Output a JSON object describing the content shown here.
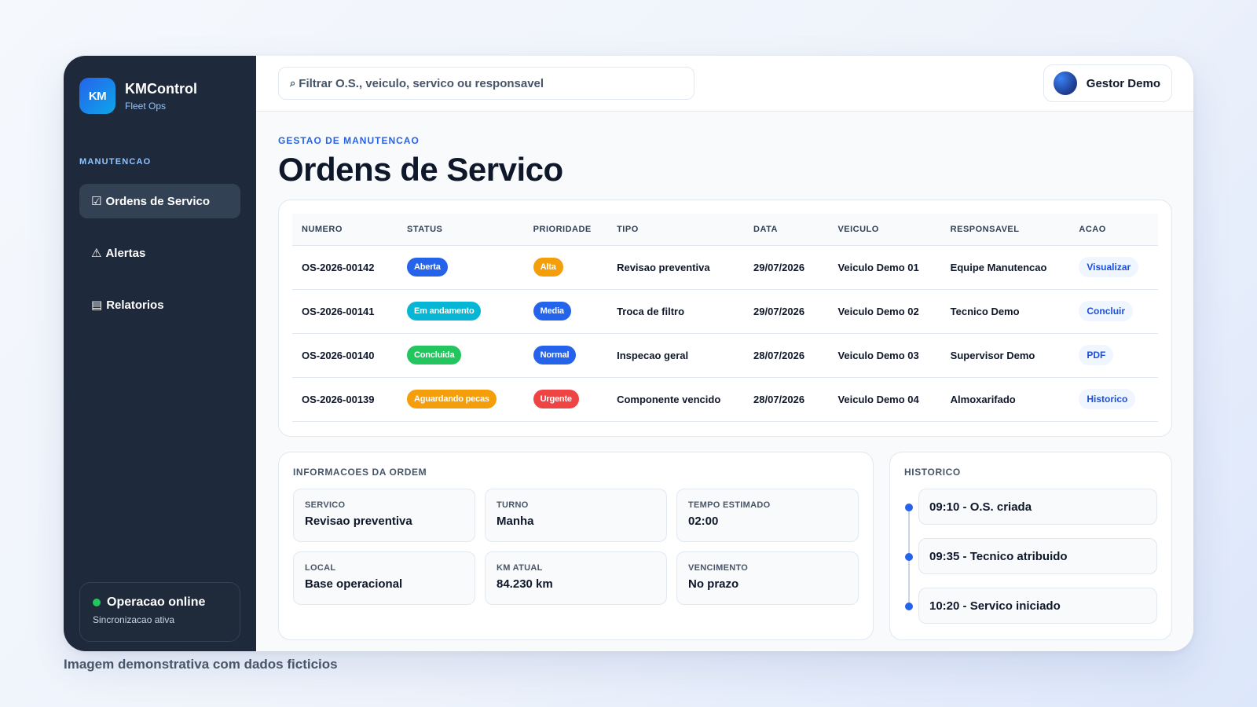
{
  "brand": {
    "logo_text": "KM",
    "name": "KMControl",
    "subtitle": "Fleet Ops"
  },
  "sidebar": {
    "section_label": "MANUTENCAO",
    "items": [
      {
        "icon": "☑",
        "icon_name": "checkbox-icon",
        "label": "Ordens de Servico",
        "active": true
      },
      {
        "icon": "⚠",
        "icon_name": "warning-icon",
        "label": "Alertas",
        "active": false
      },
      {
        "icon": "▤",
        "icon_name": "report-icon",
        "label": "Relatorios",
        "active": false
      }
    ],
    "status": {
      "title": "Operacao online",
      "subtitle": "Sincronizacao ativa"
    }
  },
  "topbar": {
    "search_icon": "⌕",
    "search_placeholder": "Filtrar O.S., veiculo, servico ou responsavel",
    "user_name": "Gestor Demo"
  },
  "header": {
    "eyebrow": "GESTAO DE MANUTENCAO",
    "title": "Ordens de Servico"
  },
  "table": {
    "columns": [
      "NUMERO",
      "STATUS",
      "PRIORIDADE",
      "TIPO",
      "DATA",
      "VEICULO",
      "RESPONSAVEL",
      "ACAO"
    ],
    "rows": [
      {
        "numero": "OS-2026-00142",
        "status": "Aberta",
        "status_color": "#2563eb",
        "prioridade": "Alta",
        "prioridade_color": "#f59e0b",
        "tipo": "Revisao preventiva",
        "data": "29/07/2026",
        "veiculo": "Veiculo Demo 01",
        "responsavel": "Equipe Manutencao",
        "acao": "Visualizar"
      },
      {
        "numero": "OS-2026-00141",
        "status": "Em andamento",
        "status_color": "#06b6d4",
        "prioridade": "Media",
        "prioridade_color": "#2563eb",
        "tipo": "Troca de filtro",
        "data": "29/07/2026",
        "veiculo": "Veiculo Demo 02",
        "responsavel": "Tecnico Demo",
        "acao": "Concluir"
      },
      {
        "numero": "OS-2026-00140",
        "status": "Concluida",
        "status_color": "#22c55e",
        "prioridade": "Normal",
        "prioridade_color": "#2563eb",
        "tipo": "Inspecao geral",
        "data": "28/07/2026",
        "veiculo": "Veiculo Demo 03",
        "responsavel": "Supervisor Demo",
        "acao": "PDF"
      },
      {
        "numero": "OS-2026-00139",
        "status": "Aguardando pecas",
        "status_color": "#f59e0b",
        "prioridade": "Urgente",
        "prioridade_color": "#ef4444",
        "tipo": "Componente vencido",
        "data": "28/07/2026",
        "veiculo": "Veiculo Demo 04",
        "responsavel": "Almoxarifado",
        "acao": "Historico"
      }
    ]
  },
  "info": {
    "title": "INFORMACOES DA ORDEM",
    "fields": [
      {
        "label": "SERVICO",
        "value": "Revisao preventiva"
      },
      {
        "label": "TURNO",
        "value": "Manha"
      },
      {
        "label": "TEMPO ESTIMADO",
        "value": "02:00"
      },
      {
        "label": "LOCAL",
        "value": "Base operacional"
      },
      {
        "label": "KM ATUAL",
        "value": "84.230 km"
      },
      {
        "label": "VENCIMENTO",
        "value": "No prazo"
      }
    ]
  },
  "history": {
    "title": "HISTORICO",
    "events": [
      "09:10 - O.S. criada",
      "09:35 - Tecnico atribuido",
      "10:20 - Servico iniciado"
    ]
  },
  "caption": "Imagem demonstrativa com dados ficticios"
}
